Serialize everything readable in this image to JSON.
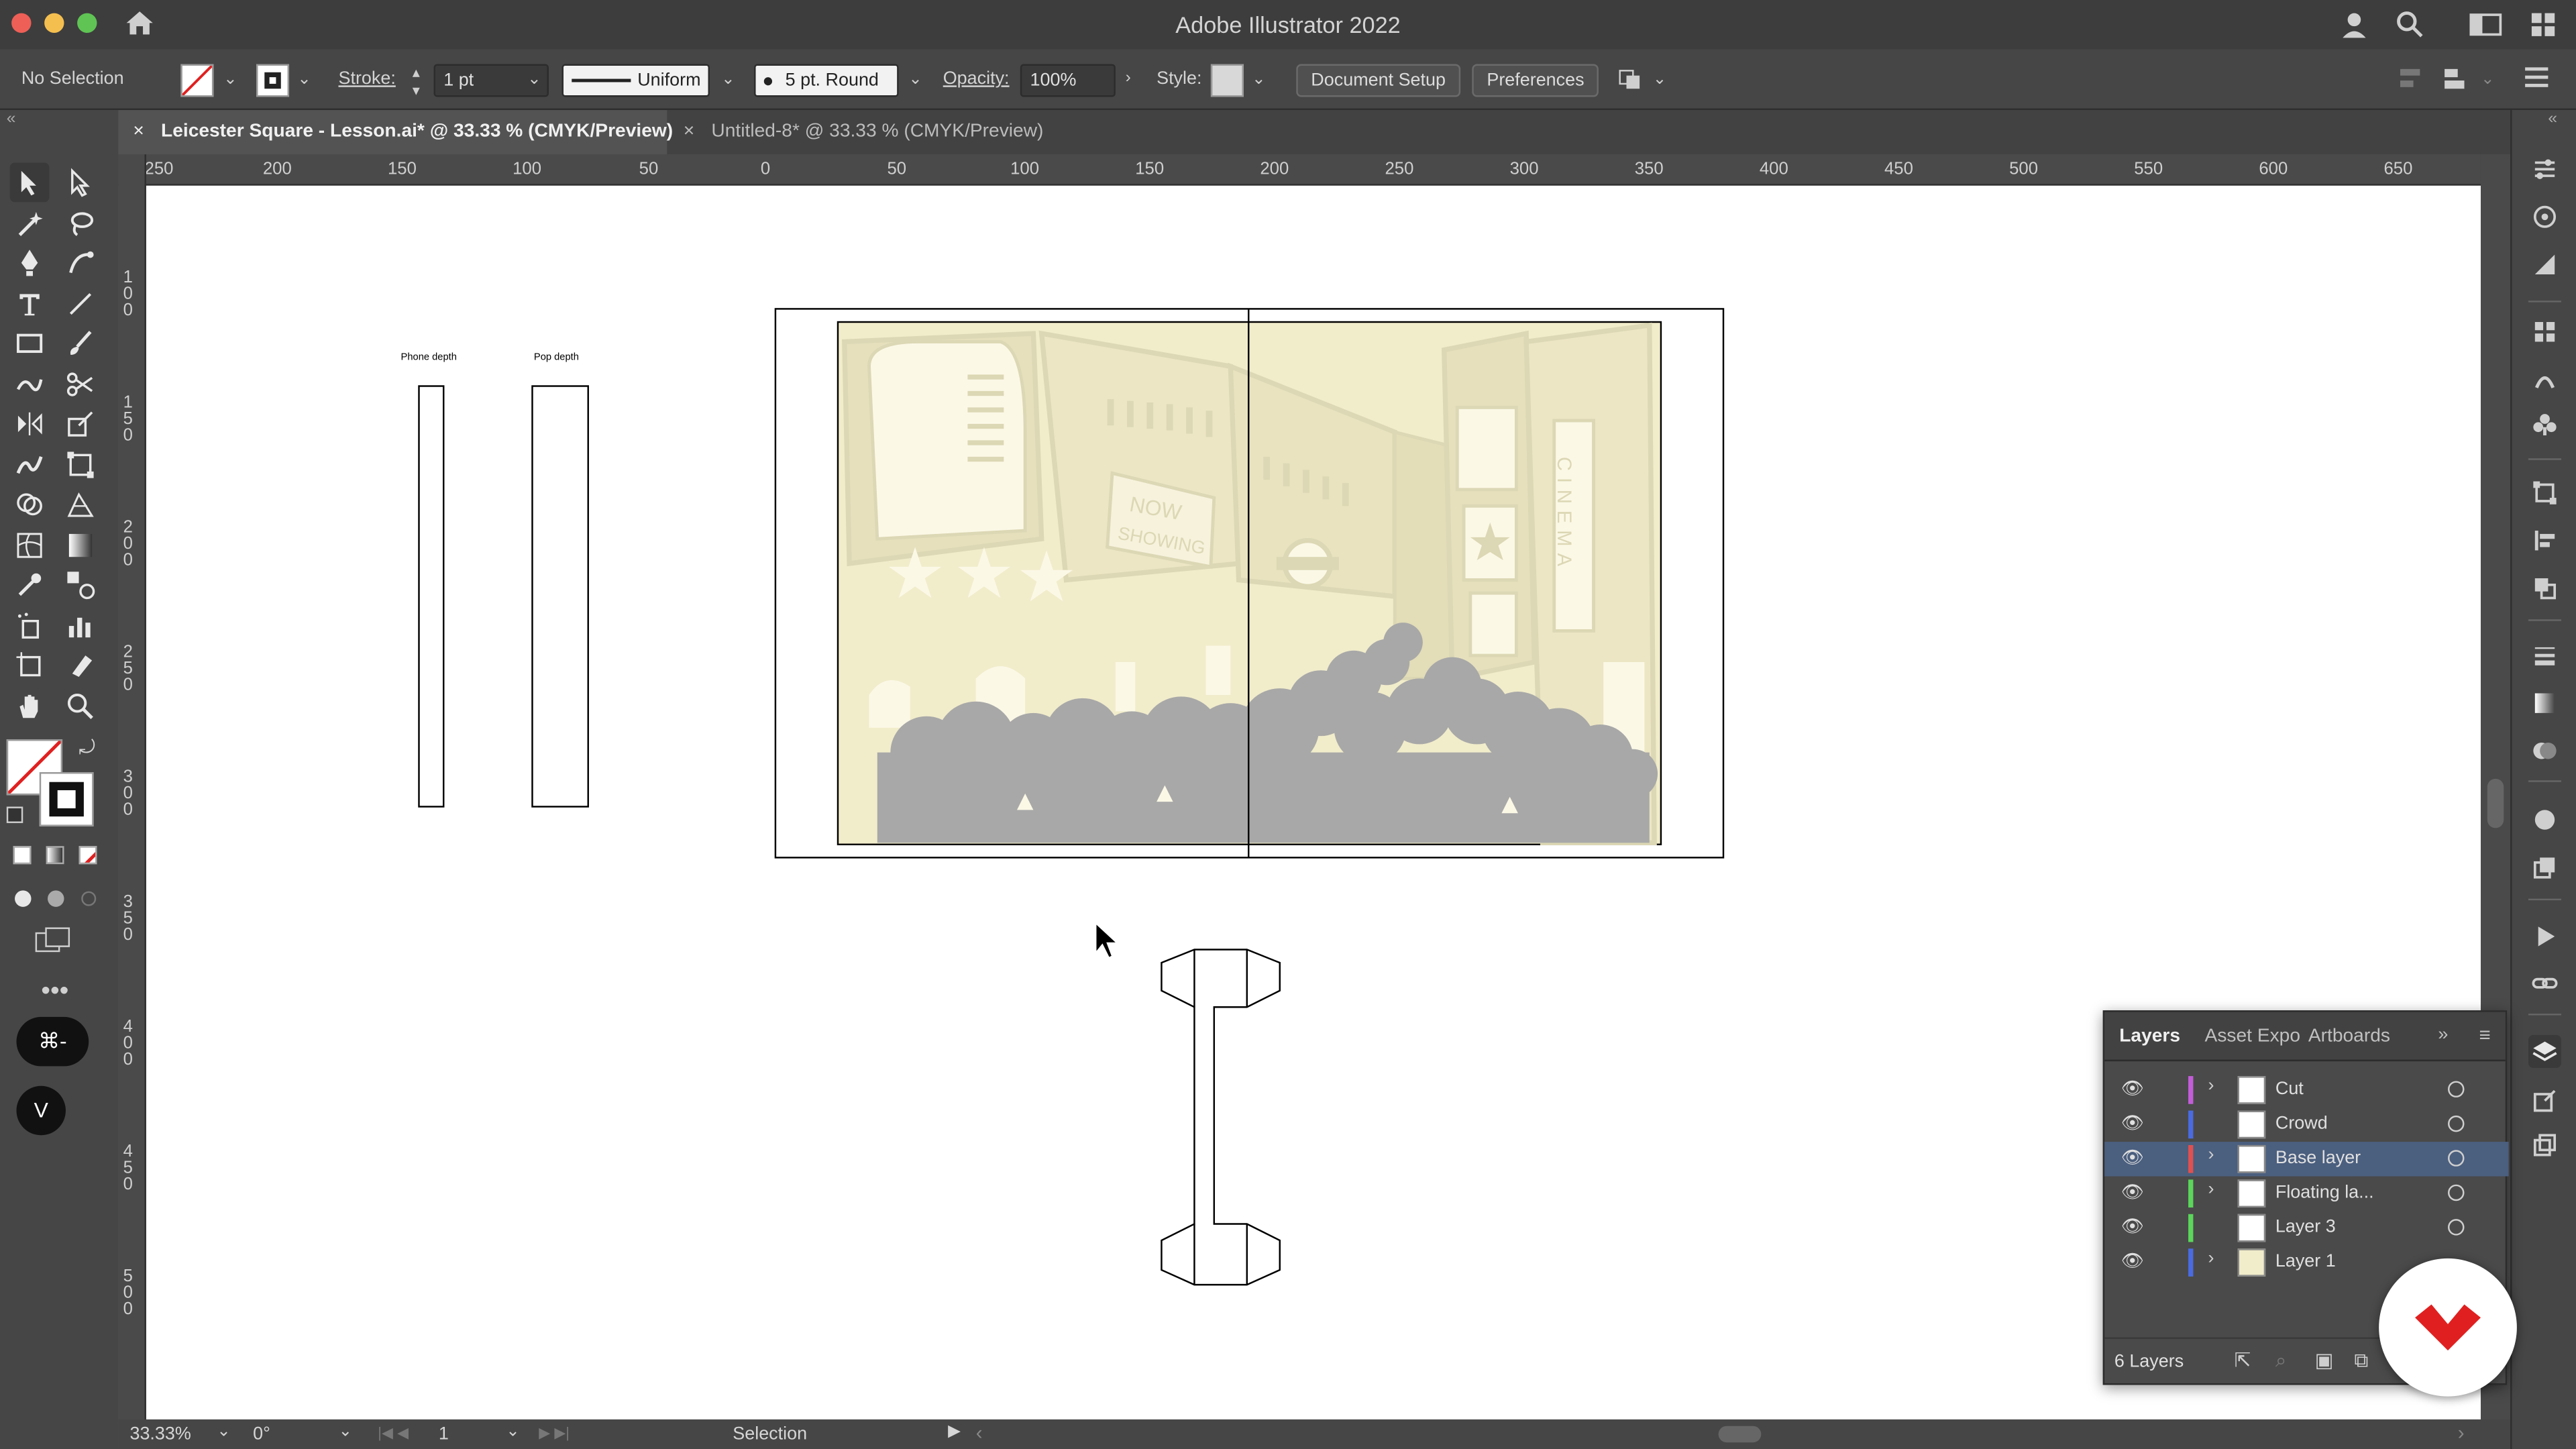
{
  "app": {
    "title": "Adobe Illustrator 2022"
  },
  "control": {
    "selection": "No Selection",
    "stroke_label": "Stroke:",
    "stroke_value": "1 pt",
    "profile": "Uniform",
    "brush": "5 pt. Round",
    "opacity_label": "Opacity:",
    "opacity_value": "100%",
    "style_label": "Style:",
    "doc_setup": "Document Setup",
    "preferences": "Preferences"
  },
  "tabs": [
    {
      "label": "Leicester Square - Lesson.ai* @ 33.33 % (CMYK/Preview)",
      "active": true
    },
    {
      "label": "Untitled-8* @ 33.33 % (CMYK/Preview)",
      "active": false
    }
  ],
  "ruler": {
    "h": [
      "250",
      "200",
      "150",
      "100",
      "50",
      "0",
      "50",
      "100",
      "150",
      "200",
      "250",
      "300",
      "350",
      "400",
      "450",
      "500",
      "550",
      "600",
      "650"
    ],
    "v": [
      "100",
      "150",
      "200",
      "250",
      "300",
      "350",
      "400",
      "450",
      "500"
    ]
  },
  "artboard": {
    "phone_depth": "Phone depth",
    "pop_depth": "Pop depth",
    "sign_now": "NOW",
    "sign_showing": "SHOWING",
    "sign_cinema": "CINEMA"
  },
  "layers_panel": {
    "tabs": [
      "Layers",
      "Asset Expo",
      "Artboards"
    ],
    "layers": [
      {
        "name": "Cut",
        "color": "#c25dd8",
        "expandable": true,
        "selected": false
      },
      {
        "name": "Crowd",
        "color": "#4a6be0",
        "expandable": false,
        "selected": false
      },
      {
        "name": "Base layer",
        "color": "#e05050",
        "expandable": true,
        "selected": true
      },
      {
        "name": "Floating la...",
        "color": "#5bd65b",
        "expandable": true,
        "selected": false
      },
      {
        "name": "Layer 3",
        "color": "#5bd65b",
        "expandable": false,
        "selected": false
      },
      {
        "name": "Layer 1",
        "color": "#4a6be0",
        "expandable": true,
        "selected": false
      }
    ],
    "count": "6 Layers"
  },
  "status": {
    "zoom": "33.33%",
    "rotation": "0°",
    "artboard_num": "1",
    "tool": "Selection"
  },
  "toolbar": {
    "shortcut": "⌘-",
    "v_badge": "V"
  },
  "colors": {
    "accent_red": "#e02020",
    "art_bg": "#f1ecca",
    "art_building": "#dcd7b4",
    "crowd": "#a8a8a8",
    "selected_row": "#4b5f7f"
  }
}
